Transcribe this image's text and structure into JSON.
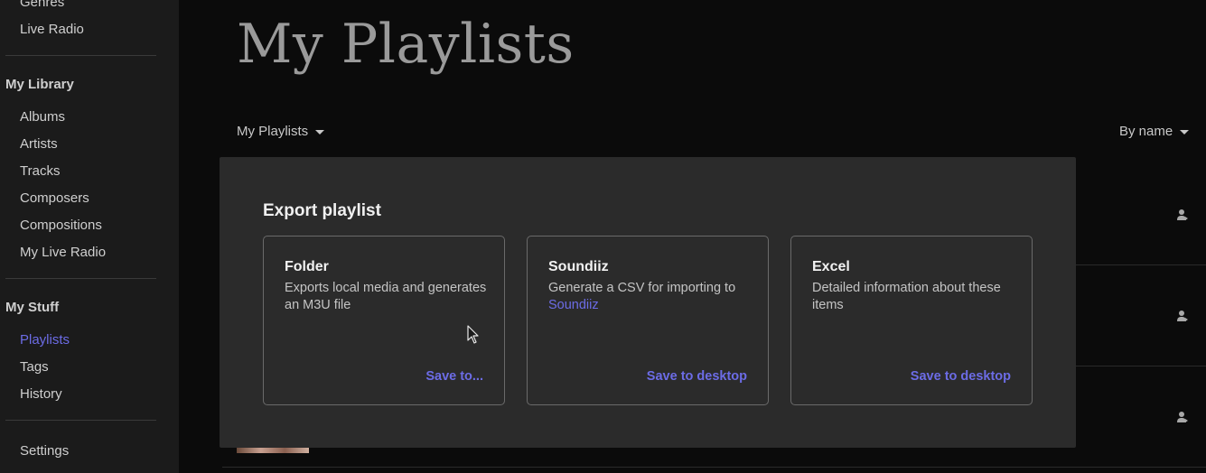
{
  "sidebar": {
    "top_items": [
      "Genres",
      "Live Radio"
    ],
    "library": {
      "title": "My Library",
      "items": [
        "Albums",
        "Artists",
        "Tracks",
        "Composers",
        "Compositions",
        "My Live Radio"
      ]
    },
    "stuff": {
      "title": "My Stuff",
      "items": [
        "Playlists",
        "Tags",
        "History"
      ],
      "active": "Playlists"
    },
    "settings": "Settings"
  },
  "main": {
    "title": "My Playlists",
    "filter_left": "My Playlists",
    "filter_right": "By name"
  },
  "modal": {
    "title": "Export playlist",
    "cards": [
      {
        "title": "Folder",
        "desc": "Exports local media and generates an M3U file",
        "action": "Save to..."
      },
      {
        "title": "Soundiiz",
        "desc": "Generate a CSV for importing to",
        "link": "Soundiiz",
        "action": "Save to desktop"
      },
      {
        "title": "Excel",
        "desc": "Detailed information about these items",
        "action": "Save to desktop"
      }
    ]
  },
  "colors": {
    "accent": "#6c6ce6",
    "sidebar_bg": "#1b1b1b",
    "main_bg": "#0b0b0b",
    "modal_bg": "#2b2b2b"
  },
  "icons": {
    "share": "person-share-icon",
    "caret": "caret-down-icon",
    "cursor": "mouse-pointer-icon"
  }
}
